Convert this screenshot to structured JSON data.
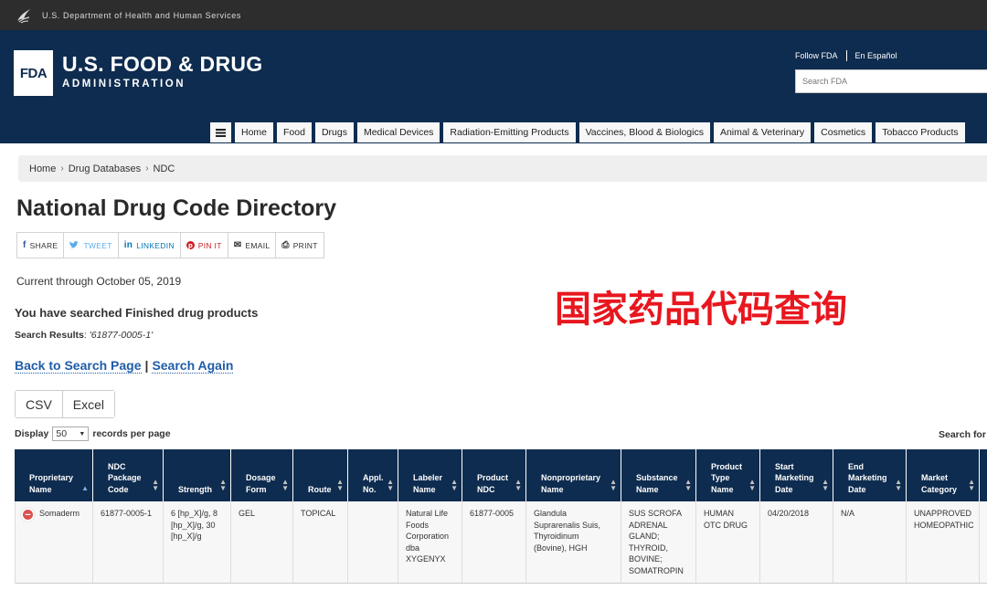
{
  "hhs_bar": {
    "text": "U.S. Department of Health and Human Services"
  },
  "header": {
    "logo_mark": "FDA",
    "title": "U.S. FOOD & DRUG",
    "subtitle": "ADMINISTRATION",
    "follow_link": "Follow FDA",
    "espanol_link": "En Español",
    "search_placeholder": "Search FDA"
  },
  "nav": {
    "items": [
      "Home",
      "Food",
      "Drugs",
      "Medical Devices",
      "Radiation-Emitting Products",
      "Vaccines, Blood & Biologics",
      "Animal & Veterinary",
      "Cosmetics",
      "Tobacco Products"
    ]
  },
  "breadcrumb": [
    "Home",
    "Drug Databases",
    "NDC"
  ],
  "page": {
    "title": "National Drug Code Directory",
    "current_through": "Current through October 05, 2019",
    "overlay_text": "国家药品代码查询",
    "searched": "You have searched Finished drug products",
    "results_label": "Search Results",
    "results_value": "'61877-0005-1'",
    "back_link": "Back to Search Page",
    "link_sep": "|",
    "again_link": "Search Again"
  },
  "share": [
    {
      "icon": "f",
      "label": "SHARE",
      "color": "#3b5998"
    },
    {
      "icon": "t",
      "label": "TWEET",
      "color": "#55acee"
    },
    {
      "icon": "in",
      "label": "LINKEDIN",
      "color": "#0077b5"
    },
    {
      "icon": "p",
      "label": "PIN IT",
      "color": "#cb2027"
    },
    {
      "icon": "✉",
      "label": "EMAIL",
      "color": "#333333"
    },
    {
      "icon": "⎙",
      "label": "PRINT",
      "color": "#333333"
    }
  ],
  "export": {
    "csv": "CSV",
    "excel": "Excel"
  },
  "display": {
    "prefix": "Display",
    "value": "50",
    "suffix": "records per page",
    "search_for": "Search for"
  },
  "table": {
    "headers": [
      "Proprietary\nName",
      "NDC\nPackage\nCode",
      "Strength",
      "Dosage\nForm",
      "Route",
      "Appl.\nNo.",
      "Labeler\nName",
      "Product\nNDC",
      "Nonproprietary\nName",
      "Substance\nName",
      "Product\nType\nName",
      "Start\nMarketing\nDate",
      "End\nMarketing\nDate",
      "Market\nCategory"
    ],
    "rows": [
      [
        "Somaderm",
        "61877-0005-1",
        "6 [hp_X]/g, 8\n[hp_X]/g, 30\n[hp_X]/g",
        "GEL",
        "TOPICAL",
        "",
        "Natural Life\nFoods\nCorporation\ndba\nXYGENYX",
        "61877-0005",
        "Glandula\nSuprarenalis Suis,\nThyroidinum\n(Bovine), HGH",
        "SUS SCROFA\nADRENAL\nGLAND;\nTHYROID,\nBOVINE;\nSOMATROPIN",
        "HUMAN\nOTC DRUG",
        "04/20/2018",
        "N/A",
        "UNAPPROVED\nHOMEOPATHIC"
      ]
    ]
  },
  "colors": {
    "header_bg": "#0e2c4f",
    "link": "#1f5da8",
    "overlay": "#e8161e"
  }
}
